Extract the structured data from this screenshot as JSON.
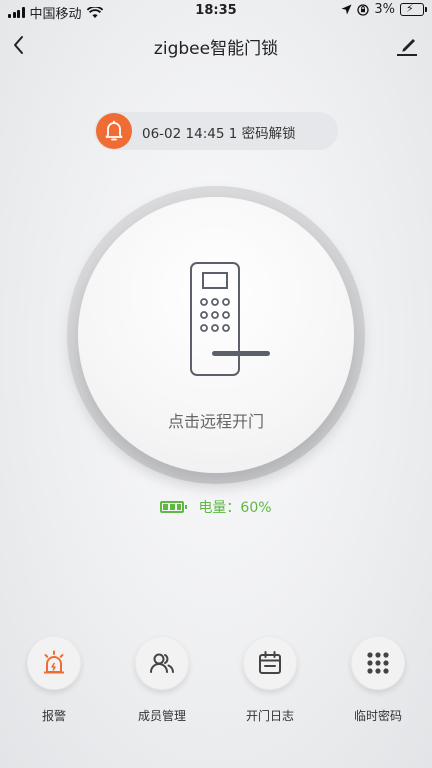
{
  "status_bar": {
    "carrier": "中国移动",
    "time": "18:35",
    "battery_pct": "3%"
  },
  "nav": {
    "title": "zigbee智能门锁"
  },
  "notice": {
    "text": "06-02 14:45  1 密码解锁"
  },
  "dial": {
    "label": "点击远程开门"
  },
  "battery": {
    "text": "电量：60%",
    "level": 0.6
  },
  "functions": [
    {
      "label": "报警",
      "icon": "alarm-icon"
    },
    {
      "label": "成员管理",
      "icon": "members-icon"
    },
    {
      "label": "开门日志",
      "icon": "calendar-icon"
    },
    {
      "label": "临时密码",
      "icon": "keypad-icon"
    }
  ],
  "colors": {
    "accent": "#ef6d35",
    "battery_green": "#5fb844"
  }
}
